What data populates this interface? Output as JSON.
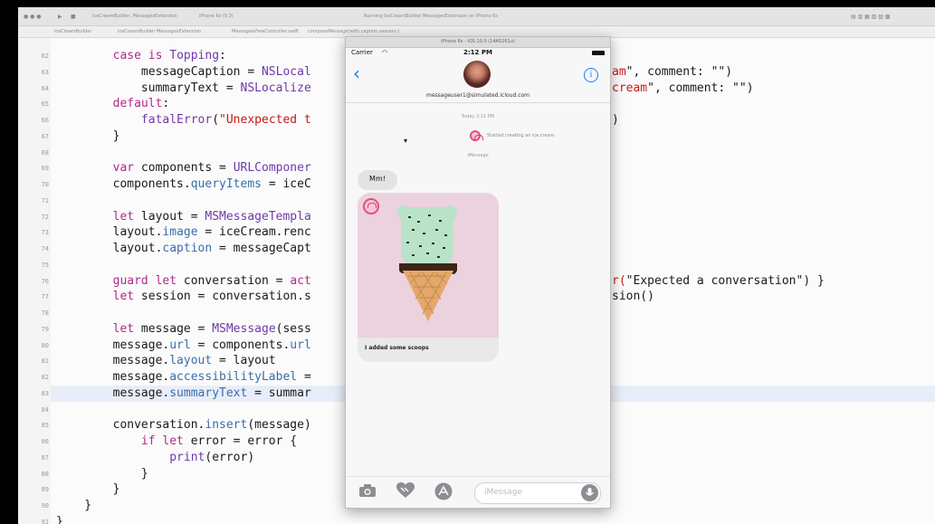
{
  "toolbar": {
    "tab_texts": [
      "IceCreamBuilder, MessagesExtension",
      "iPhone 6s (9.3)",
      "Running IceCreamBuilder MessagesExtension on iPhone 6s"
    ]
  },
  "jumpbar": {
    "crumbs": [
      "IceCreamBuilder",
      "IceCreamBuilder MessagesExtension",
      "MessagesViewController.swift",
      "composeMessage(with:caption:session:)"
    ]
  },
  "editor": {
    "lines": [
      {
        "num": "62",
        "highlight": false,
        "segments": [
          {
            "t": "        "
          },
          {
            "c": "kw",
            "t": "case is"
          },
          {
            "t": " "
          },
          {
            "c": "ty",
            "t": "Topping"
          },
          {
            "t": ":"
          }
        ]
      },
      {
        "num": "63",
        "highlight": false,
        "segments": [
          {
            "t": "            messageCaption = "
          },
          {
            "c": "ty",
            "t": "NSLocal"
          }
        ]
      },
      {
        "num": "64",
        "highlight": false,
        "segments": [
          {
            "t": "            summaryText = "
          },
          {
            "c": "ty",
            "t": "NSLocalize"
          }
        ]
      },
      {
        "num": "65",
        "highlight": false,
        "segments": [
          {
            "t": "        "
          },
          {
            "c": "kw",
            "t": "default"
          },
          {
            "t": ":"
          }
        ]
      },
      {
        "num": "66",
        "highlight": false,
        "segments": [
          {
            "t": "            "
          },
          {
            "c": "ty",
            "t": "fatalError"
          },
          {
            "t": "("
          },
          {
            "c": "st",
            "t": "\"Unexpected t"
          }
        ]
      },
      {
        "num": "67",
        "highlight": false,
        "segments": [
          {
            "t": "        }"
          }
        ]
      },
      {
        "num": "68",
        "highlight": false,
        "segments": []
      },
      {
        "num": "69",
        "highlight": false,
        "segments": [
          {
            "t": "        "
          },
          {
            "c": "kw",
            "t": "var"
          },
          {
            "t": " components = "
          },
          {
            "c": "ty",
            "t": "URLComponer"
          }
        ]
      },
      {
        "num": "70",
        "highlight": false,
        "segments": [
          {
            "t": "        components."
          },
          {
            "c": "pr",
            "t": "queryItems"
          },
          {
            "t": " = iceC"
          }
        ]
      },
      {
        "num": "71",
        "highlight": false,
        "segments": []
      },
      {
        "num": "72",
        "highlight": false,
        "segments": [
          {
            "t": "        "
          },
          {
            "c": "kw",
            "t": "let"
          },
          {
            "t": " layout = "
          },
          {
            "c": "ty",
            "t": "MSMessageTempla"
          }
        ]
      },
      {
        "num": "73",
        "highlight": false,
        "segments": [
          {
            "t": "        layout."
          },
          {
            "c": "pr",
            "t": "image"
          },
          {
            "t": " = iceCream.renc"
          }
        ]
      },
      {
        "num": "74",
        "highlight": false,
        "segments": [
          {
            "t": "        layout."
          },
          {
            "c": "pr",
            "t": "caption"
          },
          {
            "t": " = messageCapt"
          }
        ]
      },
      {
        "num": "75",
        "highlight": false,
        "segments": []
      },
      {
        "num": "76",
        "highlight": false,
        "segments": [
          {
            "t": "        "
          },
          {
            "c": "kw",
            "t": "guard let"
          },
          {
            "t": " conversation = "
          },
          {
            "c": "kw",
            "t": "act"
          }
        ]
      },
      {
        "num": "77",
        "highlight": false,
        "segments": [
          {
            "t": "        "
          },
          {
            "c": "kw",
            "t": "let"
          },
          {
            "t": " session = conversation.s"
          }
        ]
      },
      {
        "num": "78",
        "highlight": false,
        "segments": []
      },
      {
        "num": "79",
        "highlight": false,
        "segments": [
          {
            "t": "        "
          },
          {
            "c": "kw",
            "t": "let"
          },
          {
            "t": " message = "
          },
          {
            "c": "ty",
            "t": "MSMessage"
          },
          {
            "t": "(sess"
          }
        ]
      },
      {
        "num": "80",
        "highlight": false,
        "segments": [
          {
            "t": "        message."
          },
          {
            "c": "pr",
            "t": "url"
          },
          {
            "t": " = components."
          },
          {
            "c": "pr",
            "t": "url"
          }
        ]
      },
      {
        "num": "81",
        "highlight": false,
        "segments": [
          {
            "t": "        message."
          },
          {
            "c": "pr",
            "t": "layout"
          },
          {
            "t": " = layout"
          }
        ]
      },
      {
        "num": "82",
        "highlight": false,
        "segments": [
          {
            "t": "        message."
          },
          {
            "c": "pr",
            "t": "accessibilityLabel"
          },
          {
            "t": " ="
          }
        ]
      },
      {
        "num": "83",
        "highlight": true,
        "segments": [
          {
            "t": "        message."
          },
          {
            "c": "pr",
            "t": "summaryText"
          },
          {
            "t": " = summar"
          }
        ]
      },
      {
        "num": "84",
        "highlight": false,
        "segments": []
      },
      {
        "num": "85",
        "highlight": false,
        "segments": [
          {
            "t": "        conversation."
          },
          {
            "c": "pr",
            "t": "insert"
          },
          {
            "t": "(message)"
          }
        ]
      },
      {
        "num": "86",
        "highlight": false,
        "segments": [
          {
            "t": "            "
          },
          {
            "c": "kw",
            "t": "if let"
          },
          {
            "t": " error = error {"
          }
        ]
      },
      {
        "num": "87",
        "highlight": false,
        "segments": [
          {
            "t": "                "
          },
          {
            "c": "ty",
            "t": "print"
          },
          {
            "t": "(error)"
          }
        ]
      },
      {
        "num": "88",
        "highlight": false,
        "segments": [
          {
            "t": "            }"
          }
        ]
      },
      {
        "num": "89",
        "highlight": false,
        "segments": [
          {
            "t": "        }"
          }
        ]
      },
      {
        "num": "90",
        "highlight": false,
        "segments": [
          {
            "t": "    }"
          }
        ]
      },
      {
        "num": "91",
        "highlight": false,
        "segments": [
          {
            "t": "}"
          }
        ]
      }
    ],
    "right_fragments": [
      {
        "line_index": 1,
        "text": "am\", comment: \"\")"
      },
      {
        "line_index": 2,
        "text": "cream\", comment: \"\")"
      },
      {
        "line_index": 4,
        "text": ")"
      },
      {
        "line_index": 14,
        "text": "r(\"Expected a conversation\") }"
      },
      {
        "line_index": 15,
        "text": "sion()"
      }
    ]
  },
  "simulator": {
    "title": "iPhone 6s - iOS 10.0 (14A5261u)",
    "status": {
      "carrier": "Carrier",
      "time": "2:12 PM"
    },
    "nav": {
      "recipient": "messageuser1@simulated.icloud.com",
      "back_icon": "chevron-left-icon",
      "info_icon": "info-circle-icon"
    },
    "conversation": {
      "timestamp": "Today 2:11 PM",
      "status_text": "Started creating an ice cream",
      "service_label": "iMessage",
      "bubble_text": "Mm!",
      "caption": "I added some scoops"
    },
    "input": {
      "placeholder": "iMessage",
      "camera_icon": "camera-icon",
      "heart_icon": "digital-touch-heart-icon",
      "appstore_icon": "app-store-icon",
      "mic_icon": "microphone-icon"
    }
  },
  "colors": {
    "keyword": "#b0288a",
    "type": "#6e3aa8",
    "property": "#3b6ea8",
    "string": "#c41a16",
    "ios_blue": "#1a7cf5",
    "avatar_pink": "#e0507e"
  }
}
